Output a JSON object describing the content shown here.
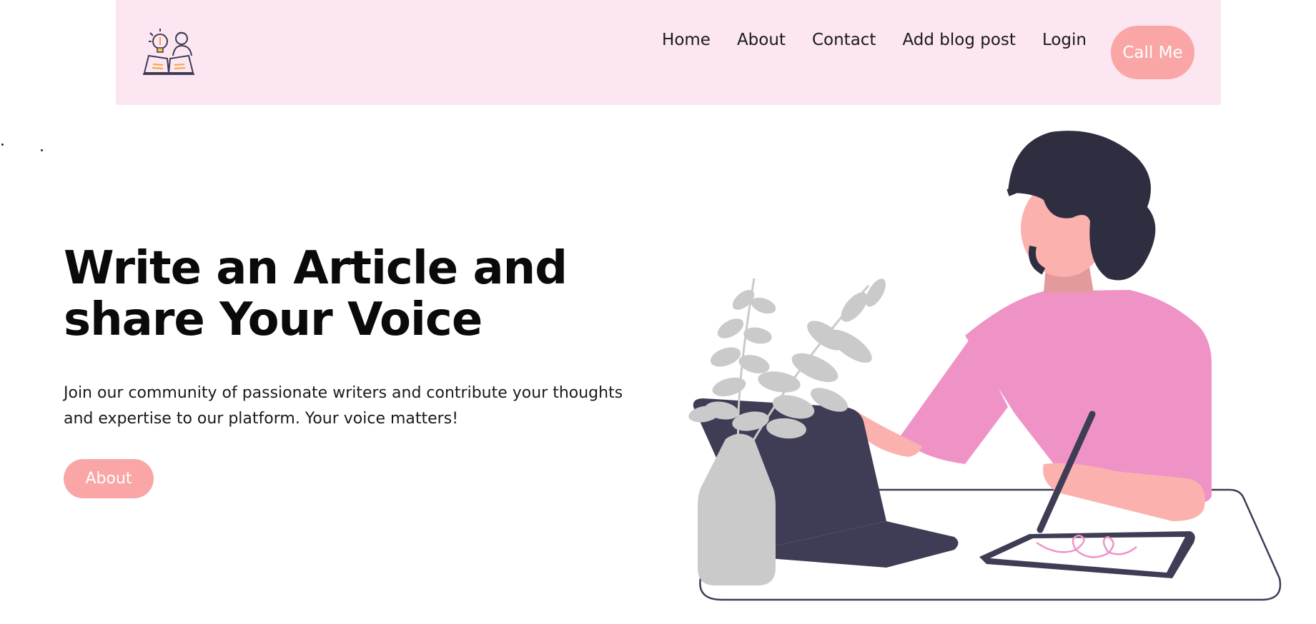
{
  "header": {
    "logo_icon": "writer-lightbulb-book-icon",
    "nav": [
      {
        "label": "Home"
      },
      {
        "label": "About"
      },
      {
        "label": "Contact"
      },
      {
        "label": "Add blog post"
      },
      {
        "label": "Login"
      }
    ],
    "cta_label": "Call Me"
  },
  "hero": {
    "title_line1": "Write an Article and",
    "title_line2": "share Your Voice",
    "description": "Join our community of passionate writers and contribute your thoughts and expertise to our platform. Your voice matters!",
    "button_label": "About",
    "illustration_icon": "woman-writing-on-tablet-illustration"
  },
  "colors": {
    "navbar_bg": "#fce6f1",
    "accent": "#fba6a6",
    "shirt": "#ef93c7",
    "dark": "#3f3d56",
    "plant": "#cacaca"
  }
}
